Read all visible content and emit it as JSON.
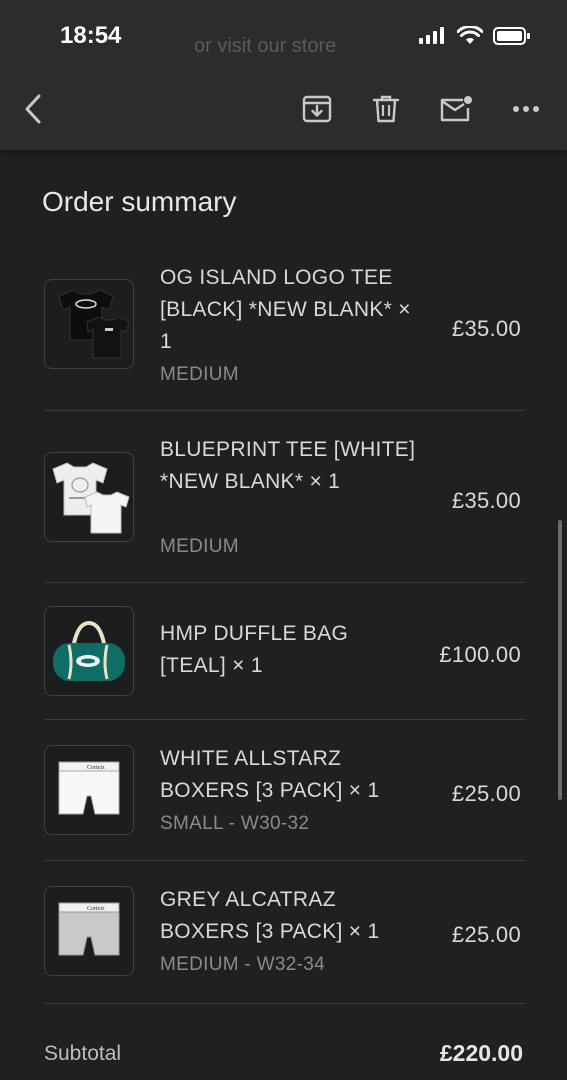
{
  "status_bar": {
    "time": "18:54"
  },
  "ghost_text": "or visit our store",
  "toolbar": {
    "back_icon": "chevron-left-icon",
    "archive_icon": "archive-icon",
    "delete_icon": "trash-icon",
    "mark_unread_icon": "mail-unread-icon",
    "more_icon": "more-horizontal-icon"
  },
  "section_title": "Order summary",
  "items": [
    {
      "name": "OG ISLAND LOGO TEE [BLACK] *NEW BLANK* × 1",
      "variant": "MEDIUM",
      "price": "£35.00"
    },
    {
      "name": "BLUEPRINT TEE [WHITE] *NEW BLANK* × 1",
      "variant": "MEDIUM",
      "price": "£35.00"
    },
    {
      "name": "HMP DUFFLE BAG [TEAL] × 1",
      "variant": "",
      "price": "£100.00"
    },
    {
      "name": "WHITE ALLSTARZ BOXERS [3 PACK] × 1",
      "variant": "SMALL - W30-32",
      "price": "£25.00"
    },
    {
      "name": "GREY ALCATRAZ BOXERS [3 PACK] × 1",
      "variant": "MEDIUM - W32-34",
      "price": "£25.00"
    }
  ],
  "subtotal": {
    "label": "Subtotal",
    "value": "£220.00"
  },
  "colors": {
    "background": "#1f2022",
    "toolbar": "#2b2c2e",
    "divider": "#3a3b3e",
    "teal": "#0f6d66"
  }
}
